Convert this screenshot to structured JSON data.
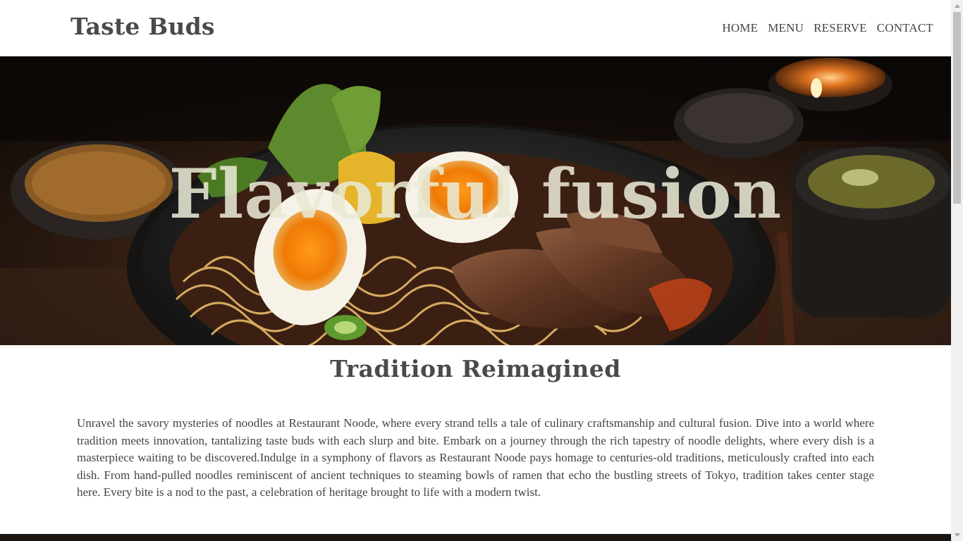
{
  "header": {
    "brand": "Taste Buds",
    "nav": [
      "HOME",
      "MENU",
      "RESERVE",
      "CONTACT"
    ]
  },
  "hero": {
    "title": "Flavorful fusion"
  },
  "main": {
    "section_title": "Tradition Reimagined",
    "intro": "Unravel the savory mysteries of noodles at Restaurant Noode, where every strand tells a tale of culinary craftsmanship and cultural fusion. Dive into a world where tradition meets innovation, tantalizing taste buds with each slurp and bite. Embark on a journey through the rich tapestry of noodle delights, where every dish is a masterpiece waiting to be discovered.Indulge in a symphony of flavors as Restaurant Noode pays homage to centuries-old traditions, meticulously crafted into each dish. From hand-pulled noodles reminiscent of ancient techniques to steaming bowls of ramen that echo the bustling streets of Tokyo, tradition takes center stage here. Every bite is a nod to the past, a celebration of heritage brought to life with a modern twist."
  },
  "colors": {
    "text": "#444444",
    "hero_title": "#e8e8d4",
    "scrollbar_track": "#f1f1f1",
    "scrollbar_thumb": "#c1c1c1"
  },
  "icons": [
    "scroll-up-arrow-icon",
    "scroll-down-arrow-icon"
  ]
}
